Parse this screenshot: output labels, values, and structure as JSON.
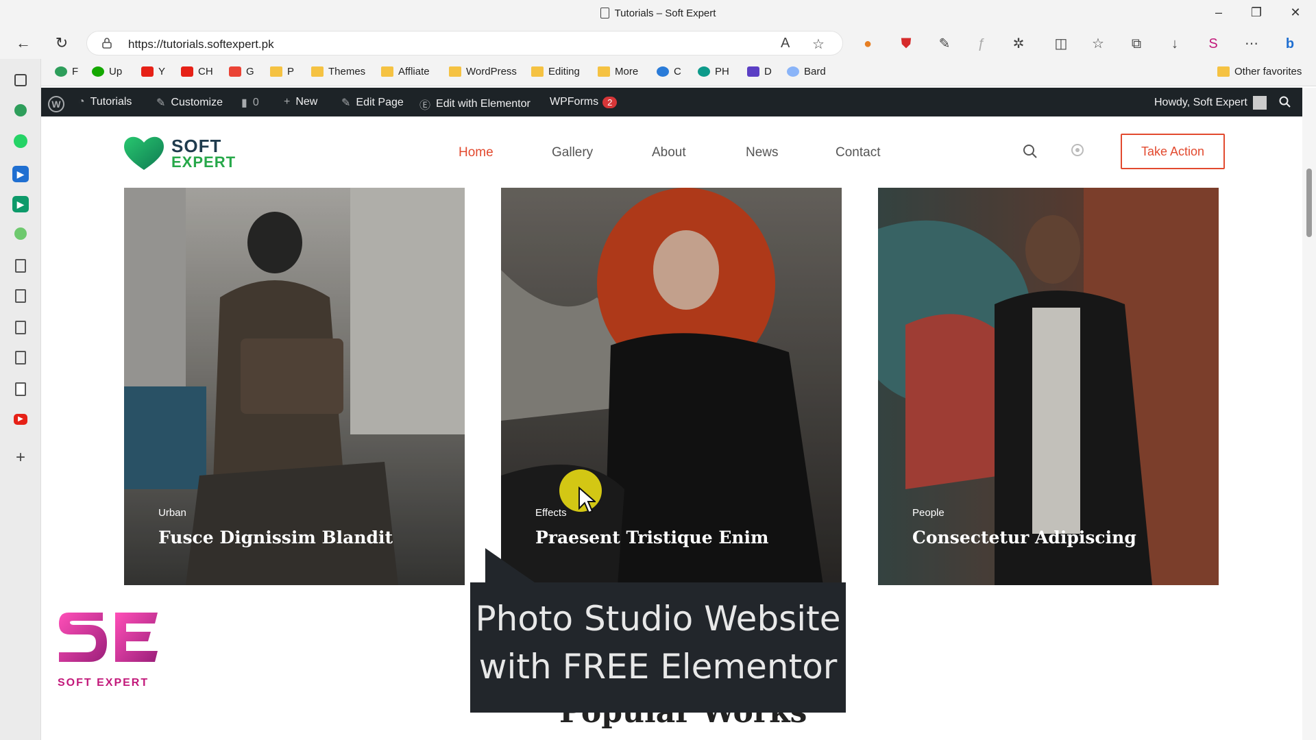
{
  "window": {
    "title": "Tutorials – Soft Expert"
  },
  "browser": {
    "url_host": "https://tutorials.softexpert.pk",
    "favorites": [
      "F",
      "Up",
      "Y",
      "CH",
      "G",
      "P",
      "Themes",
      "Affliate",
      "WordPress",
      "Editing",
      "More",
      "C",
      "PH",
      "D",
      "Bard"
    ],
    "other_favorites": "Other favorites"
  },
  "wp_admin_bar": {
    "site": "Tutorials",
    "customize": "Customize",
    "comments": "0",
    "new": "New",
    "edit_page": "Edit Page",
    "edit_elementor": "Edit with Elementor",
    "wpforms": "WPForms",
    "wpforms_count": "2",
    "howdy": "Howdy, Soft Expert"
  },
  "site": {
    "logo_line1": "SOFT",
    "logo_line2": "EXPERT",
    "nav": [
      "Home",
      "Gallery",
      "About",
      "News",
      "Contact"
    ],
    "active_nav": "Home",
    "cta": "Take Action",
    "accent": "#e2492e"
  },
  "cards": [
    {
      "category": "Urban",
      "title": "Fusce Dignissim Blandit"
    },
    {
      "category": "Effects",
      "title": "Praesent Tristique Enim"
    },
    {
      "category": "People",
      "title": "Consectetur Adipiscing"
    }
  ],
  "caption": {
    "line1": "Photo Studio Website",
    "line2": "with FREE Elementor"
  },
  "section_heading": "Popular Works",
  "watermark": "SOFT EXPERT"
}
